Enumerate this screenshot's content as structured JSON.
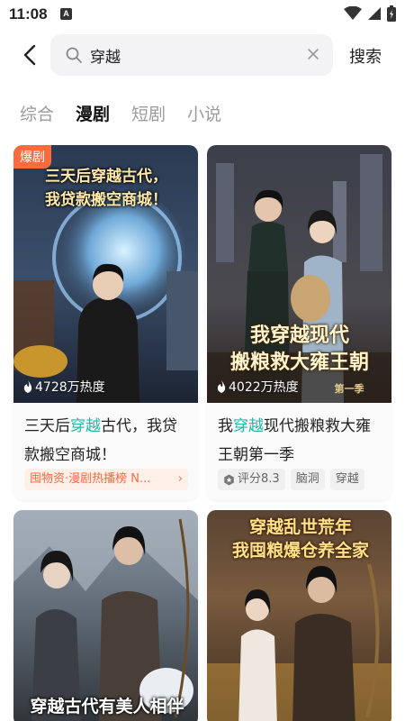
{
  "status": {
    "time": "11:08",
    "notification_letter": "A"
  },
  "search": {
    "query": "穿越",
    "button_label": "搜索"
  },
  "tabs": [
    {
      "label": "综合",
      "active": false
    },
    {
      "label": "漫剧",
      "active": true
    },
    {
      "label": "短剧",
      "active": false
    },
    {
      "label": "小说",
      "active": false
    }
  ],
  "cards": [
    {
      "badge": "爆剧",
      "heat": "4728万热度",
      "cover_title_line1": "三天后穿越古代，",
      "cover_title_line2": "我贷款搬空商城！",
      "title_pre": "三天后",
      "title_hl": "穿越",
      "title_post": "古代，我贷款搬空商城！",
      "rank_tag": "囤物资·漫剧热播榜 N..."
    },
    {
      "heat": "4022万热度",
      "cover_title_line1": "我穿越现代",
      "cover_title_line2": "搬粮救大雍王朝",
      "cover_subtitle": "第一季",
      "title_pre": "我",
      "title_hl": "穿越",
      "title_post": "现代搬粮救大雍王朝第一季",
      "rating": "评分8.3",
      "tag1": "脑洞",
      "tag2": "穿越"
    },
    {
      "cover_title_line1": "穿越古代有美人相伴"
    },
    {
      "cover_title_line1": "穿越乱世荒年",
      "cover_title_line2": "我囤粮爆仓养全家"
    }
  ],
  "colors": {
    "highlight": "#1fb8a8",
    "badge": "#ff6a3d",
    "rank_bg": "#fff0ea"
  }
}
